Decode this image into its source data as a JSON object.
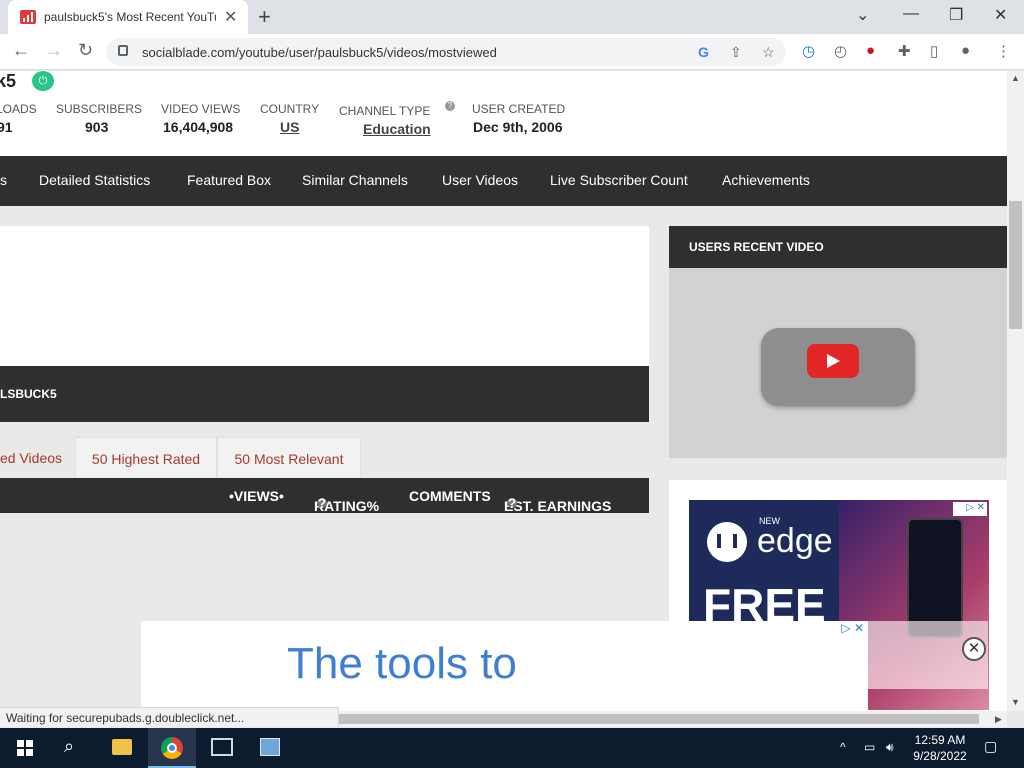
{
  "browser": {
    "tab_title": "paulsbuck5's Most Recent YouTu",
    "url": "socialblade.com/youtube/user/paulsbuck5/videos/mostviewed",
    "status_text": "Waiting for securepubads.g.doubleclick.net..."
  },
  "profile": {
    "username_fragment": "k5",
    "stats": [
      {
        "label": "LOADS",
        "value": "91"
      },
      {
        "label": "SUBSCRIBERS",
        "value": "903"
      },
      {
        "label": "VIDEO VIEWS",
        "value": "16,404,908"
      },
      {
        "label": "COUNTRY",
        "value": "US"
      },
      {
        "label": "CHANNEL TYPE",
        "value": "Education"
      },
      {
        "label": "USER CREATED",
        "value": "Dec 9th, 2006"
      }
    ]
  },
  "nav": {
    "items": [
      "s",
      "Detailed Statistics",
      "Featured Box",
      "Similar Channels",
      "User Videos",
      "Live Subscriber Count",
      "Achievements"
    ]
  },
  "videos_section": {
    "header_fragment": "LSBUCK5",
    "tabs": [
      "ed Videos",
      "50 Highest Rated",
      "50 Most Relevant"
    ],
    "columns": [
      "•VIEWS•",
      "RATING%",
      "COMMENTS",
      "EST. EARNINGS"
    ]
  },
  "sidebar": {
    "recent_video_title": "USERS RECENT VIDEO"
  },
  "ads": {
    "side_new": "NEW",
    "side_brand": "edge",
    "side_headline": "FREE",
    "bottom_text": "The tools to"
  },
  "taskbar": {
    "time": "12:59 AM",
    "date": "9/28/2022"
  },
  "colors": {
    "accent_red": "#a33b2b",
    "dark_bar": "#2f2f2f",
    "verified_green": "#2bc48a",
    "taskbar": "#0d1b2f"
  }
}
